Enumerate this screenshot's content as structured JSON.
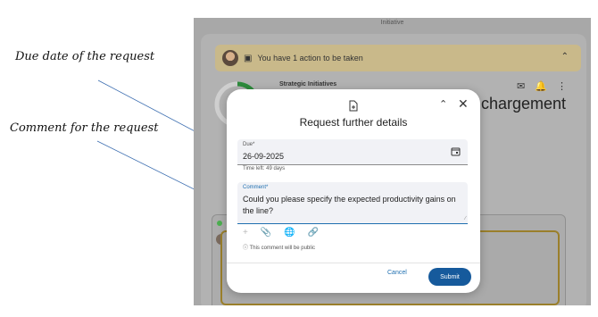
{
  "annotations": {
    "due_note": "Due date of the request",
    "comment_note": "Comment for the request"
  },
  "background": {
    "header_text": "Initiative",
    "banner_text": "You have 1 action to be taken",
    "side_title": "Strategic Initiatives",
    "page_title": "chargement"
  },
  "dialog": {
    "title": "Request further details",
    "due_label": "Due*",
    "due_value": "26-09-2025",
    "time_left": "Time left: 49 days",
    "comment_label": "Comment*",
    "comment_value": "Could you please specify the expected productivity gains on the line?",
    "public_note": "This comment will be public",
    "cancel_label": "Cancel",
    "submit_label": "Submit"
  },
  "colors": {
    "accent": "#165a9c",
    "banner": "#c9b98a",
    "progress": "#2e8b3d"
  }
}
